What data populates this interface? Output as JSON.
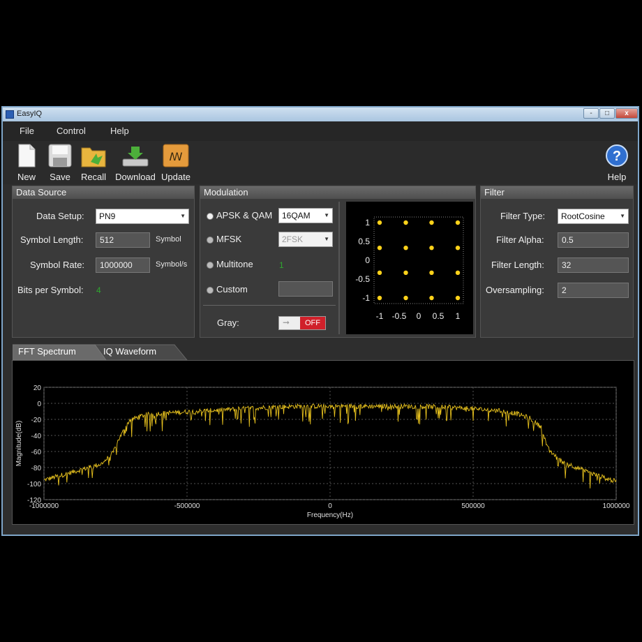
{
  "window": {
    "title": "EasyIQ",
    "close_glyph": "x",
    "minimize_glyph": "-",
    "maximize_glyph": "□"
  },
  "menu": [
    "File",
    "Control",
    "Help"
  ],
  "toolbar": {
    "new": "New",
    "save": "Save",
    "recall": "Recall",
    "download": "Download",
    "update": "Update",
    "help": "Help",
    "help_glyph": "?",
    "update_glyph": "ꟿ"
  },
  "data_source": {
    "header": "Data Source",
    "data_setup_label": "Data Setup:",
    "data_setup_value": "PN9",
    "symbol_length_label": "Symbol Length:",
    "symbol_length_value": "512",
    "symbol_length_unit": "Symbol",
    "symbol_rate_label": "Symbol Rate:",
    "symbol_rate_value": "1000000",
    "symbol_rate_unit": "Symbol/s",
    "bits_label": "Bits per Symbol:",
    "bits_value": "4"
  },
  "modulation": {
    "header": "Modulation",
    "apsk_label": "APSK & QAM",
    "apsk_value": "16QAM",
    "mfsk_label": "MFSK",
    "mfsk_value": "2FSK",
    "multitone_label": "Multitone",
    "multitone_value": "1",
    "custom_label": "Custom",
    "gray_label": "Gray:",
    "gray_state": "OFF",
    "selected": "APSK & QAM",
    "constellation": {
      "points": [
        [
          -1,
          1
        ],
        [
          -0.33,
          1
        ],
        [
          0.33,
          1
        ],
        [
          1,
          1
        ],
        [
          -1,
          0.33
        ],
        [
          -0.33,
          0.33
        ],
        [
          0.33,
          0.33
        ],
        [
          1,
          0.33
        ],
        [
          -1,
          -0.33
        ],
        [
          -0.33,
          -0.33
        ],
        [
          0.33,
          -0.33
        ],
        [
          1,
          -0.33
        ],
        [
          -1,
          -1
        ],
        [
          -0.33,
          -1
        ],
        [
          0.33,
          -1
        ],
        [
          1,
          -1
        ]
      ],
      "y_ticks": [
        "1",
        "0.5",
        "0",
        "-0.5",
        "-1"
      ],
      "x_ticks": [
        "-1",
        "-0.5",
        "0",
        "0.5",
        "1"
      ],
      "point_color": "#ffd21a"
    }
  },
  "filter": {
    "header": "Filter",
    "type_label": "Filter Type:",
    "type_value": "RootCosine",
    "alpha_label": "Filter Alpha:",
    "alpha_value": "0.5",
    "length_label": "Filter Length:",
    "length_value": "32",
    "oversampling_label": "Oversampling:",
    "oversampling_value": "2"
  },
  "tabs": [
    {
      "label": "FFT Spectrum",
      "active": true
    },
    {
      "label": "IQ Waveform",
      "active": false
    }
  ],
  "chart_data": {
    "type": "line",
    "title": "",
    "xlabel": "Frequency(Hz)",
    "ylabel": "Magnitude(dB)",
    "xlim": [
      -1000000,
      1000000
    ],
    "ylim": [
      -120,
      20
    ],
    "x_ticks": [
      "-1000000",
      "-500000",
      "0",
      "500000",
      "1000000"
    ],
    "y_ticks": [
      "20",
      "0",
      "-20",
      "-40",
      "-60",
      "-80",
      "-100",
      "-120"
    ],
    "grid": true,
    "line_color": "#e8c21e",
    "series": [
      {
        "x": [
          -1000000,
          -900000,
          -800000,
          -760000,
          -740000,
          -700000,
          -650000,
          -600000,
          -500000,
          -400000,
          -300000,
          -200000,
          -100000,
          0,
          100000,
          200000,
          300000,
          400000,
          500000,
          600000,
          650000,
          700000,
          740000,
          760000,
          800000,
          900000,
          1000000
        ],
        "y": [
          -95,
          -85,
          -75,
          -62,
          -45,
          -20,
          -14,
          -12,
          -10,
          -8,
          -6,
          -4,
          -3,
          -3,
          -3,
          -3,
          -3,
          -4,
          -6,
          -9,
          -12,
          -18,
          -30,
          -55,
          -70,
          -85,
          -97
        ]
      }
    ]
  }
}
